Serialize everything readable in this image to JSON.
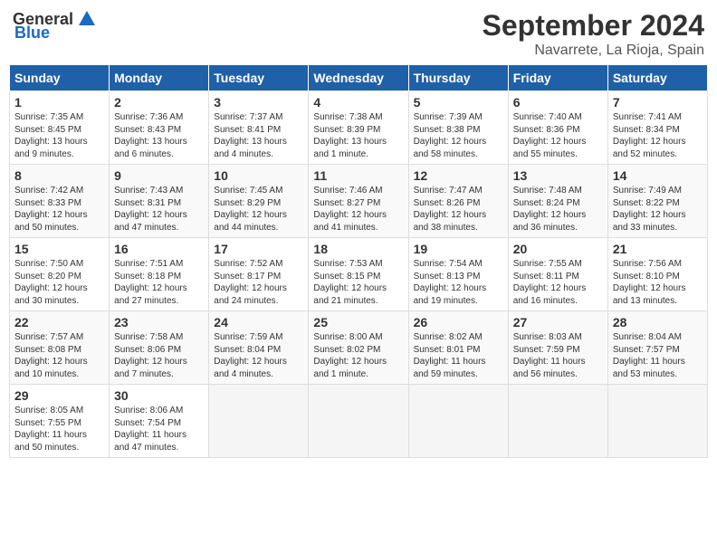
{
  "header": {
    "logo_general": "General",
    "logo_blue": "Blue",
    "month": "September 2024",
    "location": "Navarrete, La Rioja, Spain"
  },
  "columns": [
    "Sunday",
    "Monday",
    "Tuesday",
    "Wednesday",
    "Thursday",
    "Friday",
    "Saturday"
  ],
  "weeks": [
    [
      {
        "day": "1",
        "sunrise": "Sunrise: 7:35 AM",
        "sunset": "Sunset: 8:45 PM",
        "daylight": "Daylight: 13 hours and 9 minutes."
      },
      {
        "day": "2",
        "sunrise": "Sunrise: 7:36 AM",
        "sunset": "Sunset: 8:43 PM",
        "daylight": "Daylight: 13 hours and 6 minutes."
      },
      {
        "day": "3",
        "sunrise": "Sunrise: 7:37 AM",
        "sunset": "Sunset: 8:41 PM",
        "daylight": "Daylight: 13 hours and 4 minutes."
      },
      {
        "day": "4",
        "sunrise": "Sunrise: 7:38 AM",
        "sunset": "Sunset: 8:39 PM",
        "daylight": "Daylight: 13 hours and 1 minute."
      },
      {
        "day": "5",
        "sunrise": "Sunrise: 7:39 AM",
        "sunset": "Sunset: 8:38 PM",
        "daylight": "Daylight: 12 hours and 58 minutes."
      },
      {
        "day": "6",
        "sunrise": "Sunrise: 7:40 AM",
        "sunset": "Sunset: 8:36 PM",
        "daylight": "Daylight: 12 hours and 55 minutes."
      },
      {
        "day": "7",
        "sunrise": "Sunrise: 7:41 AM",
        "sunset": "Sunset: 8:34 PM",
        "daylight": "Daylight: 12 hours and 52 minutes."
      }
    ],
    [
      {
        "day": "8",
        "sunrise": "Sunrise: 7:42 AM",
        "sunset": "Sunset: 8:33 PM",
        "daylight": "Daylight: 12 hours and 50 minutes."
      },
      {
        "day": "9",
        "sunrise": "Sunrise: 7:43 AM",
        "sunset": "Sunset: 8:31 PM",
        "daylight": "Daylight: 12 hours and 47 minutes."
      },
      {
        "day": "10",
        "sunrise": "Sunrise: 7:45 AM",
        "sunset": "Sunset: 8:29 PM",
        "daylight": "Daylight: 12 hours and 44 minutes."
      },
      {
        "day": "11",
        "sunrise": "Sunrise: 7:46 AM",
        "sunset": "Sunset: 8:27 PM",
        "daylight": "Daylight: 12 hours and 41 minutes."
      },
      {
        "day": "12",
        "sunrise": "Sunrise: 7:47 AM",
        "sunset": "Sunset: 8:26 PM",
        "daylight": "Daylight: 12 hours and 38 minutes."
      },
      {
        "day": "13",
        "sunrise": "Sunrise: 7:48 AM",
        "sunset": "Sunset: 8:24 PM",
        "daylight": "Daylight: 12 hours and 36 minutes."
      },
      {
        "day": "14",
        "sunrise": "Sunrise: 7:49 AM",
        "sunset": "Sunset: 8:22 PM",
        "daylight": "Daylight: 12 hours and 33 minutes."
      }
    ],
    [
      {
        "day": "15",
        "sunrise": "Sunrise: 7:50 AM",
        "sunset": "Sunset: 8:20 PM",
        "daylight": "Daylight: 12 hours and 30 minutes."
      },
      {
        "day": "16",
        "sunrise": "Sunrise: 7:51 AM",
        "sunset": "Sunset: 8:18 PM",
        "daylight": "Daylight: 12 hours and 27 minutes."
      },
      {
        "day": "17",
        "sunrise": "Sunrise: 7:52 AM",
        "sunset": "Sunset: 8:17 PM",
        "daylight": "Daylight: 12 hours and 24 minutes."
      },
      {
        "day": "18",
        "sunrise": "Sunrise: 7:53 AM",
        "sunset": "Sunset: 8:15 PM",
        "daylight": "Daylight: 12 hours and 21 minutes."
      },
      {
        "day": "19",
        "sunrise": "Sunrise: 7:54 AM",
        "sunset": "Sunset: 8:13 PM",
        "daylight": "Daylight: 12 hours and 19 minutes."
      },
      {
        "day": "20",
        "sunrise": "Sunrise: 7:55 AM",
        "sunset": "Sunset: 8:11 PM",
        "daylight": "Daylight: 12 hours and 16 minutes."
      },
      {
        "day": "21",
        "sunrise": "Sunrise: 7:56 AM",
        "sunset": "Sunset: 8:10 PM",
        "daylight": "Daylight: 12 hours and 13 minutes."
      }
    ],
    [
      {
        "day": "22",
        "sunrise": "Sunrise: 7:57 AM",
        "sunset": "Sunset: 8:08 PM",
        "daylight": "Daylight: 12 hours and 10 minutes."
      },
      {
        "day": "23",
        "sunrise": "Sunrise: 7:58 AM",
        "sunset": "Sunset: 8:06 PM",
        "daylight": "Daylight: 12 hours and 7 minutes."
      },
      {
        "day": "24",
        "sunrise": "Sunrise: 7:59 AM",
        "sunset": "Sunset: 8:04 PM",
        "daylight": "Daylight: 12 hours and 4 minutes."
      },
      {
        "day": "25",
        "sunrise": "Sunrise: 8:00 AM",
        "sunset": "Sunset: 8:02 PM",
        "daylight": "Daylight: 12 hours and 1 minute."
      },
      {
        "day": "26",
        "sunrise": "Sunrise: 8:02 AM",
        "sunset": "Sunset: 8:01 PM",
        "daylight": "Daylight: 11 hours and 59 minutes."
      },
      {
        "day": "27",
        "sunrise": "Sunrise: 8:03 AM",
        "sunset": "Sunset: 7:59 PM",
        "daylight": "Daylight: 11 hours and 56 minutes."
      },
      {
        "day": "28",
        "sunrise": "Sunrise: 8:04 AM",
        "sunset": "Sunset: 7:57 PM",
        "daylight": "Daylight: 11 hours and 53 minutes."
      }
    ],
    [
      {
        "day": "29",
        "sunrise": "Sunrise: 8:05 AM",
        "sunset": "Sunset: 7:55 PM",
        "daylight": "Daylight: 11 hours and 50 minutes."
      },
      {
        "day": "30",
        "sunrise": "Sunrise: 8:06 AM",
        "sunset": "Sunset: 7:54 PM",
        "daylight": "Daylight: 11 hours and 47 minutes."
      },
      null,
      null,
      null,
      null,
      null
    ]
  ]
}
